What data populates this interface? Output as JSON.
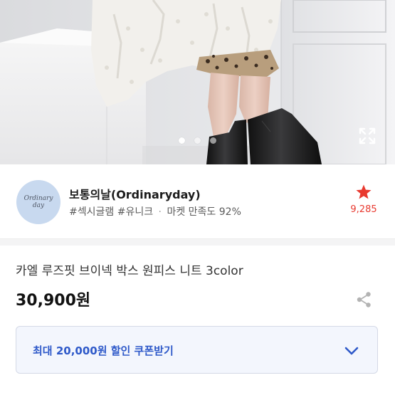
{
  "hero": {
    "carousel_total": 3,
    "carousel_active": 1
  },
  "seller": {
    "avatar_line1": "Ordinary",
    "avatar_line2": "day",
    "name": "보통의날(Ordinaryday)",
    "tags": [
      "#섹시글램",
      "#유니크"
    ],
    "separator": "·",
    "satisfaction": "마켓 만족도 92%",
    "favorite_count": "9,285"
  },
  "product": {
    "title": "카엘 루즈핏 브이넥 박스 원피스 니트 3color",
    "price": "30,900원"
  },
  "coupon": {
    "label": "최대 20,000원 할인 쿠폰받기"
  },
  "colors": {
    "accent_blue": "#2e59c9",
    "favorite_red": "#e8392f",
    "avatar_bg": "#c8d9ef"
  },
  "icons": {
    "expand": "expand-icon",
    "star": "star-icon",
    "share": "share-icon",
    "chevron": "chevron-down-icon"
  }
}
